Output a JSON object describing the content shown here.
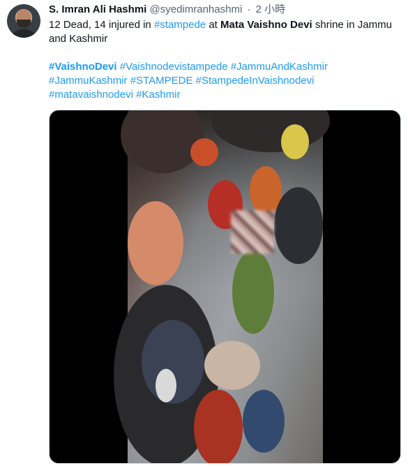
{
  "tweet": {
    "name": "S. Imran Ali Hashmi",
    "handle": "@syedimranhashmi",
    "separator": "·",
    "time": "2 小時",
    "line1": {
      "a": "12 Dead, 14 injured in ",
      "b": "#stampede",
      "c": " at ",
      "d": "Mata Vaishno Devi",
      "e": " shrine in Jammu and Kashmir"
    },
    "hashtags": [
      "#VaishnoDevi",
      "#Vaishnodevistampede",
      "#JammuAndKashmir",
      "#JammuKashmir",
      "#STAMPEDE",
      "#StampedeInVaishnodevi",
      "#matavaishnodevi",
      "#Kashmir"
    ]
  },
  "colors": {
    "link": "#1d9bf0",
    "secondary": "#536471",
    "text": "#0f1419"
  }
}
